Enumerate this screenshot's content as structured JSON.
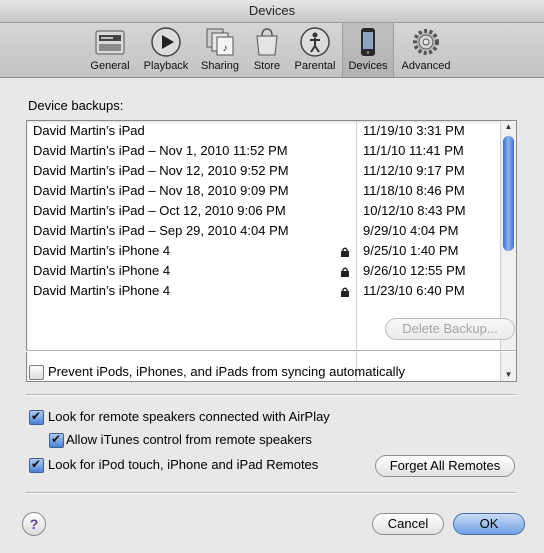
{
  "window": {
    "title": "Devices"
  },
  "toolbar": {
    "items": [
      {
        "label": "General",
        "icon": "general-icon",
        "selected": false
      },
      {
        "label": "Playback",
        "icon": "playback-icon",
        "selected": false
      },
      {
        "label": "Sharing",
        "icon": "sharing-icon",
        "selected": false
      },
      {
        "label": "Store",
        "icon": "store-icon",
        "selected": false
      },
      {
        "label": "Parental",
        "icon": "parental-icon",
        "selected": false
      },
      {
        "label": "Devices",
        "icon": "devices-icon",
        "selected": true
      },
      {
        "label": "Advanced",
        "icon": "advanced-icon",
        "selected": false
      }
    ]
  },
  "backups": {
    "label": "Device backups:",
    "rows": [
      {
        "name": "David Martin’s iPad",
        "date": "11/19/10 3:31 PM",
        "locked": false
      },
      {
        "name": "David Martin’s iPad – Nov 1, 2010 11:52 PM",
        "date": "11/1/10 11:41 PM",
        "locked": false
      },
      {
        "name": "David Martin’s iPad – Nov 12, 2010 9:52 PM",
        "date": "11/12/10 9:17 PM",
        "locked": false
      },
      {
        "name": "David Martin’s iPad – Nov 18, 2010 9:09 PM",
        "date": "11/18/10 8:46 PM",
        "locked": false
      },
      {
        "name": "David Martin’s iPad – Oct 12, 2010 9:06 PM",
        "date": "10/12/10 8:43 PM",
        "locked": false
      },
      {
        "name": "David Martin’s iPad – Sep 29, 2010 4:04 PM",
        "date": "9/29/10 4:04 PM",
        "locked": false
      },
      {
        "name": "David Martin’s iPhone 4",
        "date": "9/25/10 1:40 PM",
        "locked": true
      },
      {
        "name": "David Martin’s iPhone 4",
        "date": "9/26/10 12:55 PM",
        "locked": true
      },
      {
        "name": "David Martin’s iPhone 4",
        "date": "11/23/10 6:40 PM",
        "locked": true
      }
    ],
    "delete_label": "Delete Backup..."
  },
  "options": {
    "prevent_sync": {
      "label": "Prevent iPods, iPhones, and iPads from syncing automatically",
      "checked": false
    },
    "airplay": {
      "label": "Look for remote speakers connected with AirPlay",
      "checked": true
    },
    "allow_control": {
      "label": "Allow iTunes control from remote speakers",
      "checked": true
    },
    "remotes": {
      "label": "Look for iPod touch, iPhone and iPad Remotes",
      "checked": true
    },
    "forget_label": "Forget All Remotes"
  },
  "footer": {
    "help_label": "?",
    "cancel_label": "Cancel",
    "ok_label": "OK"
  }
}
